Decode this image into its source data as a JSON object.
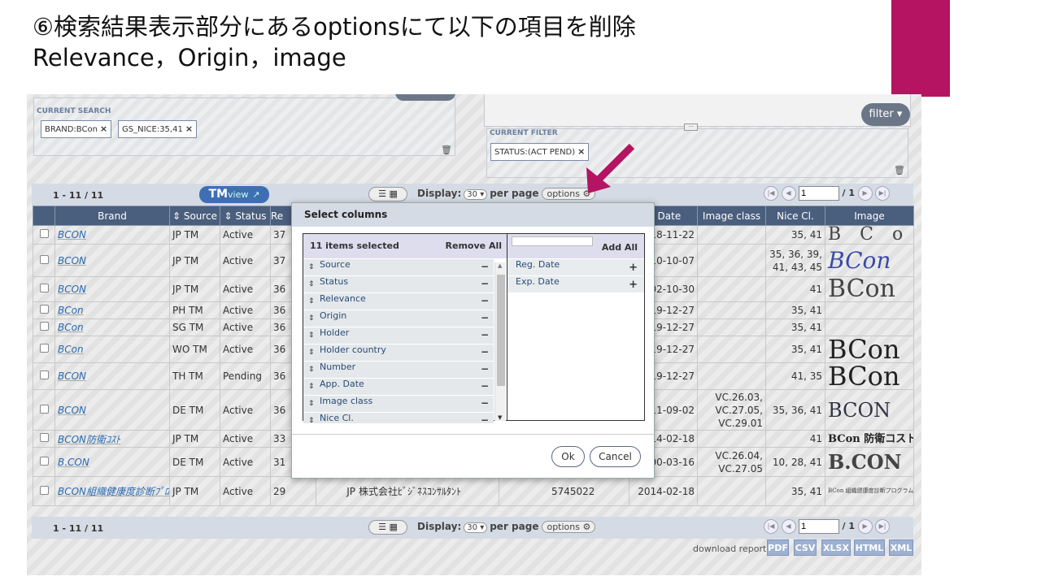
{
  "slide": {
    "title_line1": "⑥検索結果表示部分にあるoptionsにて以下の項目を削除",
    "title_line2": "Relevance，Origin，image",
    "accent_color": "#b41461"
  },
  "current_search": {
    "label": "CURRENT SEARCH",
    "tags": [
      "BRAND:BCon",
      "GS_NICE:35,41"
    ]
  },
  "current_filter": {
    "label": "CURRENT FILTER",
    "tags": [
      "STATUS:(ACT PEND)"
    ],
    "filter_button": "filter"
  },
  "toolbar": {
    "count": "1 - 11 / 11",
    "tm": "TM",
    "view": "view",
    "display_label": "Display:",
    "display_value": "30",
    "per_page": "per page",
    "options": "options",
    "page_value": "1",
    "page_total": "/ 1"
  },
  "table": {
    "headers": [
      "Brand",
      "Source",
      "Status",
      "Re",
      "o. Date",
      "Image class",
      "Nice Cl.",
      "Image"
    ],
    "rows": [
      {
        "brand": "BCON",
        "source": "JP TM",
        "status": "Active",
        "rel": "37",
        "date": "18-11-22",
        "imgclass": "",
        "nice": "35, 41",
        "logo": "B C o n"
      },
      {
        "brand": "BCON",
        "source": "JP TM",
        "status": "Active",
        "rel": "37",
        "date": "10-10-07",
        "imgclass": "",
        "nice": "35, 36, 39, 41, 43, 45",
        "logo": "BCon"
      },
      {
        "brand": "BCON",
        "source": "JP TM",
        "status": "Active",
        "rel": "36",
        "date": "02-10-30",
        "imgclass": "",
        "nice": "41",
        "logo": "BCon"
      },
      {
        "brand": "BCon",
        "source": "PH TM",
        "status": "Active",
        "rel": "36",
        "date": "19-12-27",
        "imgclass": "",
        "nice": "35, 41",
        "logo": ""
      },
      {
        "brand": "BCon",
        "source": "SG TM",
        "status": "Active",
        "rel": "36",
        "date": "19-12-27",
        "imgclass": "",
        "nice": "35, 41",
        "logo": ""
      },
      {
        "brand": "BCon",
        "source": "WO TM",
        "status": "Active",
        "rel": "36",
        "date": "19-12-27",
        "imgclass": "",
        "nice": "35, 41",
        "logo": "BCon"
      },
      {
        "brand": "BCON",
        "source": "TH TM",
        "status": "Pending",
        "rel": "36",
        "date": "19-12-27",
        "imgclass": "",
        "nice": "41, 35",
        "logo": "BCon"
      },
      {
        "brand": "BCON",
        "source": "DE TM",
        "status": "Active",
        "rel": "36",
        "date": "11-09-02",
        "imgclass": "VC.26.03, VC.27.05, VC.29.01",
        "nice": "35, 36, 41",
        "logo": "BCON"
      },
      {
        "brand": "BCON防衛ｺｽﾄ",
        "source": "JP TM",
        "status": "Active",
        "rel": "33",
        "date": "14-02-18",
        "imgclass": "",
        "nice": "41",
        "logo": "BCon 防衛コスト"
      },
      {
        "brand": "B.CON",
        "source": "DE TM",
        "status": "Active",
        "rel": "31",
        "date": "00-03-16",
        "imgclass": "VC.26.04, VC.27.05",
        "nice": "10, 28, 41",
        "logo": "B.CON"
      },
      {
        "brand": "BCON組織健康度診断ﾌﾟﾛｸﾞﾗﾑ",
        "source": "JP TM",
        "status": "Active",
        "rel": "29",
        "date": "2014-02-18",
        "imgclass": "",
        "nice": "35, 41",
        "logo": "BCon 組織健康度診断プログラム",
        "origin": "JP",
        "holder": "株式会社ﾋﾞｼﾞﾈｽｺﾝｻﾙﾀﾝﾄ",
        "number": "5745022"
      }
    ]
  },
  "modal": {
    "title": "Select columns",
    "selected_count": "11 items selected",
    "remove_all": "Remove All",
    "add_all": "Add All",
    "selected_items": [
      "Source",
      "Status",
      "Relevance",
      "Origin",
      "Holder",
      "Holder country",
      "Number",
      "App. Date",
      "Image class",
      "Nice Cl."
    ],
    "available_items": [
      "Reg. Date",
      "Exp. Date"
    ],
    "ok": "Ok",
    "cancel": "Cancel"
  },
  "download": {
    "label": "download report",
    "formats": [
      "PDF",
      "CSV",
      "XLSX",
      "HTML",
      "XML"
    ]
  }
}
